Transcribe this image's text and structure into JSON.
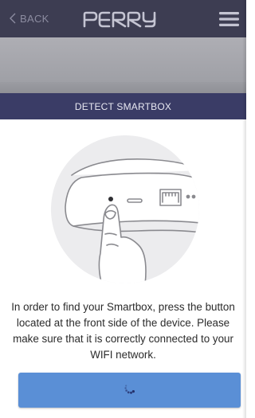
{
  "header": {
    "back_label": "BACK",
    "logo_text": "PERRY",
    "menu_icon": "hamburger-menu-icon"
  },
  "section": {
    "title": "DETECT SMARTBOX"
  },
  "illustration": {
    "icon": "smartbox-button-press-illustration"
  },
  "instruction": {
    "text": "In order to find your Smartbox, press the button located at the front side of the device. Please make sure that it is correctly connected to your WIFI network."
  },
  "action_button": {
    "icon": "loading-spinner-icon"
  },
  "colors": {
    "topbar": "#3d3d52",
    "section_bar": "#3a3c66",
    "button": "#5a8fd6",
    "text": "#2b2b2b"
  }
}
